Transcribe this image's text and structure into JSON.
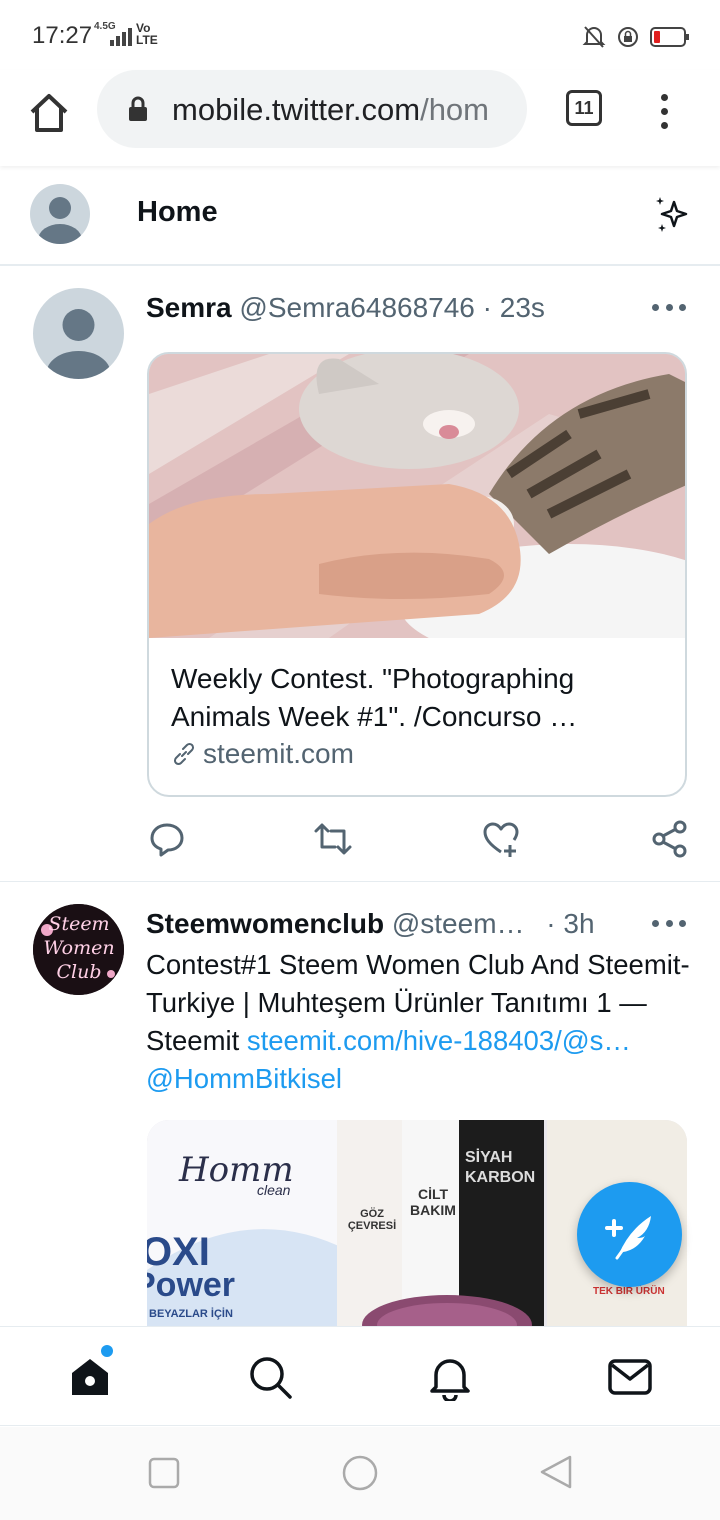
{
  "status_bar": {
    "time": "17:27",
    "network": "4.5G",
    "volte": "Vo\nLTE"
  },
  "browser": {
    "url_main": "mobile.twitter.com",
    "url_rest": "/hom",
    "tab_count": "11"
  },
  "header": {
    "title": "Home"
  },
  "tweets": [
    {
      "name": "Semra",
      "handle": "@Semra64868746",
      "time": "23s",
      "card": {
        "title": "Weekly Contest. \"Photographing Animals Week #1\". /Concurso …",
        "domain": "steemit.com"
      }
    },
    {
      "name": "Steemwomenclub",
      "handle": "@steem…",
      "time": "3h",
      "text": "Contest#1 Steem Women Club And Steemit-Turkiye  | Muhteşem Ürünler Tanıtımı 1 — Steemit ",
      "link1": "steemit.com/hive-188403/@s…",
      "link2": "@HommBitkisel",
      "avatar_text": "Steem Women Club"
    }
  ],
  "product_image_text": {
    "brand": "Homm",
    "brand_sub": "clean",
    "oxi": "OXI",
    "power": "Power",
    "beyazlar": "BEYAZLAR İÇİN",
    "goz": "GÖZ ÇEVRESİ",
    "cilt": "CİLT BAKIM",
    "siyah": "SİYAH KARBON",
    "tek": "TEK BİR ÜRÜN"
  },
  "colors": {
    "accent": "#1d9bf0",
    "text": "#0f1419",
    "muted": "#536471",
    "border": "#cfd9de"
  }
}
